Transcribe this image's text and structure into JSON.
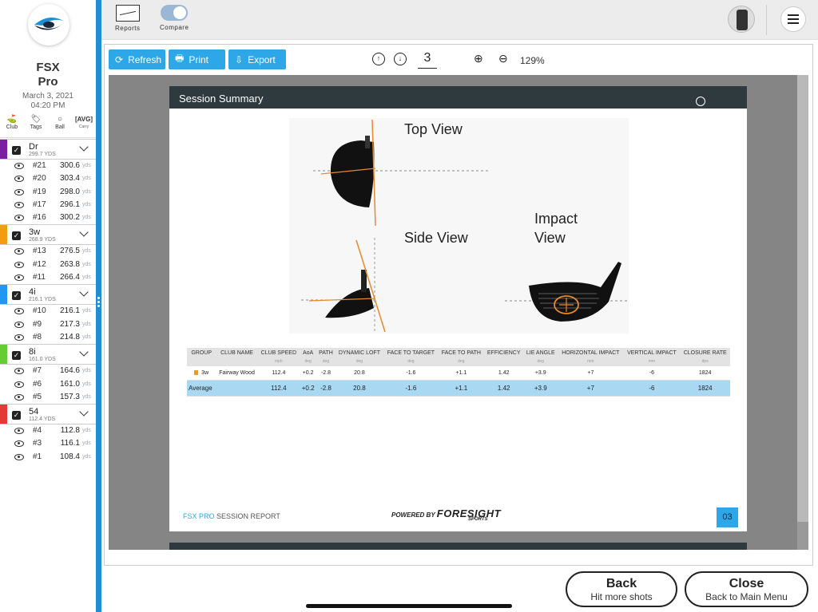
{
  "sidebar": {
    "title_line1": "FSX",
    "title_line2": "Pro",
    "date": "March 3, 2021",
    "time": "04:20 PM",
    "filters": [
      {
        "label": "Club"
      },
      {
        "label": "Tags"
      },
      {
        "label": "Ball"
      },
      {
        "label": "AVG",
        "sub": "Carry"
      }
    ],
    "clubs": [
      {
        "name": "Dr",
        "carry": "299.7",
        "unit": "YDS",
        "color": "#7b1fa2",
        "shots": [
          {
            "n": "#21",
            "v": "300.6"
          },
          {
            "n": "#20",
            "v": "303.4"
          },
          {
            "n": "#19",
            "v": "298.0"
          },
          {
            "n": "#17",
            "v": "296.1"
          },
          {
            "n": "#16",
            "v": "300.2"
          }
        ]
      },
      {
        "name": "3w",
        "carry": "268.9",
        "unit": "YDS",
        "color": "#f39c12",
        "shots": [
          {
            "n": "#13",
            "v": "276.5"
          },
          {
            "n": "#12",
            "v": "263.8"
          },
          {
            "n": "#11",
            "v": "266.4"
          }
        ]
      },
      {
        "name": "4i",
        "carry": "216.1",
        "unit": "YDS",
        "color": "#2196f3",
        "shots": [
          {
            "n": "#10",
            "v": "216.1"
          },
          {
            "n": "#9",
            "v": "217.3"
          },
          {
            "n": "#8",
            "v": "214.8"
          }
        ]
      },
      {
        "name": "8i",
        "carry": "161.0",
        "unit": "YDS",
        "color": "#66cc33",
        "shots": [
          {
            "n": "#7",
            "v": "164.6"
          },
          {
            "n": "#6",
            "v": "161.0"
          },
          {
            "n": "#5",
            "v": "157.3"
          }
        ]
      },
      {
        "name": "54",
        "carry": "112.4",
        "unit": "YDS",
        "color": "#e53935",
        "shots": [
          {
            "n": "#4",
            "v": "112.8"
          },
          {
            "n": "#3",
            "v": "116.1"
          },
          {
            "n": "#1",
            "v": "108.4"
          }
        ]
      }
    ],
    "shot_unit": "yds"
  },
  "topbar": {
    "reports_label": "Reports",
    "compare_label": "Compare"
  },
  "toolbar": {
    "refresh_label": "Refresh",
    "print_label": "Print",
    "export_label": "Export",
    "page_number": "3",
    "zoom_level": "129%"
  },
  "report": {
    "header": "Session Summary",
    "top_view": "Top View",
    "side_view": "Side View",
    "impact_view_1": "Impact",
    "impact_view_2": "View",
    "columns": [
      {
        "label": "GROUP",
        "unit": ""
      },
      {
        "label": "CLUB NAME",
        "unit": ""
      },
      {
        "label": "CLUB SPEED",
        "unit": "mph"
      },
      {
        "label": "AoA",
        "unit": "deg"
      },
      {
        "label": "PATH",
        "unit": "deg"
      },
      {
        "label": "DYNAMIC LOFT",
        "unit": "deg"
      },
      {
        "label": "FACE TO TARGET",
        "unit": "deg"
      },
      {
        "label": "FACE TO PATH",
        "unit": "deg"
      },
      {
        "label": "EFFICIENCY",
        "unit": ""
      },
      {
        "label": "LIE ANGLE",
        "unit": "deg"
      },
      {
        "label": "HORIZONTAL IMPACT",
        "unit": "mm"
      },
      {
        "label": "VERTICAL IMPACT",
        "unit": "mm"
      },
      {
        "label": "CLOSURE RATE",
        "unit": "dps"
      }
    ],
    "rows": [
      {
        "cells": [
          "3w",
          "Fairway Wood",
          "112.4",
          "+0.2",
          "-2.8",
          "20.8",
          "-1.6",
          "+1.1",
          "1.42",
          "+3.9",
          "+7",
          "-6",
          "1824"
        ],
        "marker": "#f39c12"
      }
    ],
    "average": {
      "cells": [
        "Average",
        "",
        "112.4",
        "+0.2",
        "-2.8",
        "20.8",
        "-1.6",
        "+1.1",
        "1.42",
        "+3.9",
        "+7",
        "-6",
        "1824"
      ]
    },
    "footer_brand": "FSX PRO",
    "footer_text": "SESSION REPORT",
    "powered_by": "POWERED BY",
    "powered_brand": "FORESIGHT",
    "powered_sub": "SPORTS",
    "page_box": "03"
  },
  "bottom": {
    "back_title": "Back",
    "back_sub": "Hit more shots",
    "close_title": "Close",
    "close_sub": "Back to Main Menu"
  },
  "colors": {
    "accent": "#2ea7e8",
    "divider": "#1e8fd6",
    "header_dark": "#2f3a3e",
    "average_row": "#a8d8f2"
  }
}
